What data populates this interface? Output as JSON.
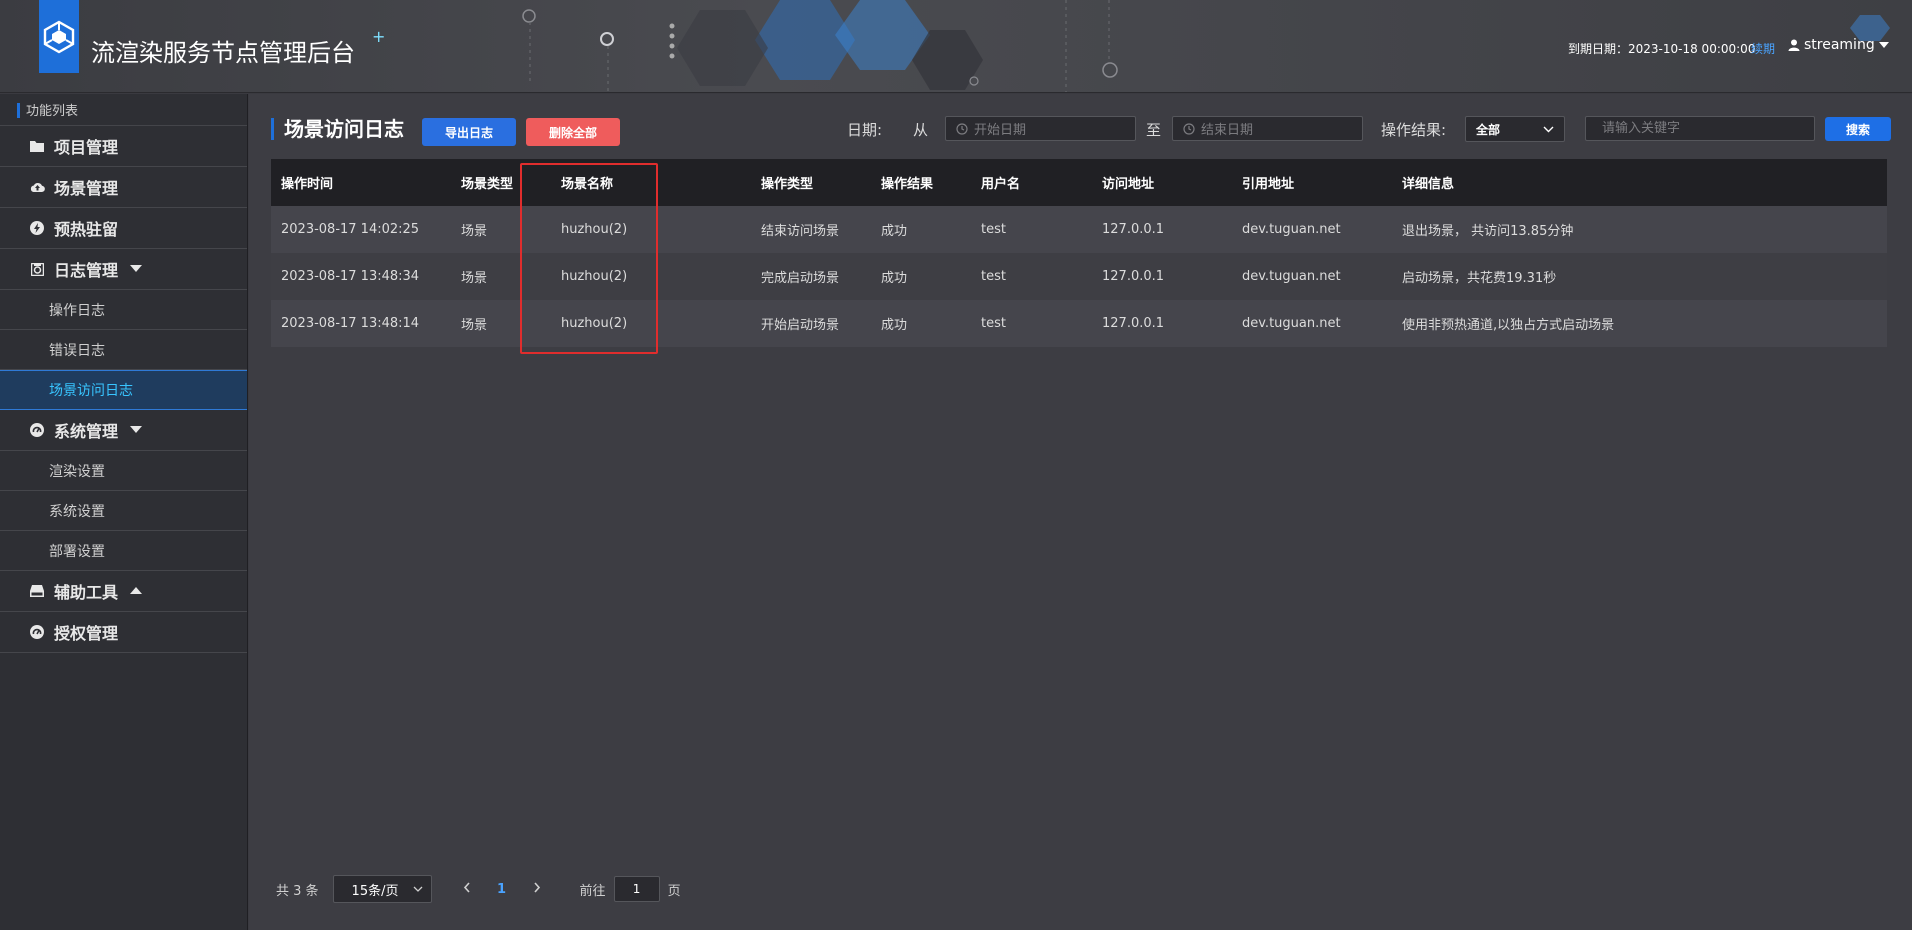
{
  "header": {
    "title": "流渲染服务节点管理后台",
    "title_suffix": "+",
    "expire_text": "到期日期：2023-10-18 00:00:00",
    "renew_label": "续期",
    "username": "streaming"
  },
  "sidebar": {
    "heading": "功能列表",
    "items": [
      {
        "label": "项目管理",
        "icon": "folder-icon"
      },
      {
        "label": "场景管理",
        "icon": "cloud-upload-icon"
      },
      {
        "label": "预热驻留",
        "icon": "bolt-icon"
      },
      {
        "label": "日志管理",
        "icon": "log-icon",
        "arrow": "down"
      },
      {
        "label": "系统管理",
        "icon": "dashboard-icon",
        "arrow": "down"
      },
      {
        "label": "辅助工具",
        "icon": "drive-icon",
        "arrow": "up"
      },
      {
        "label": "授权管理",
        "icon": "dashboard-icon"
      }
    ],
    "log_sub": [
      "操作日志",
      "错误日志",
      "场景访问日志"
    ],
    "sys_sub": [
      "渲染设置",
      "系统设置",
      "部署设置"
    ],
    "active_item": "场景访问日志"
  },
  "toolbar": {
    "page_title": "场景访问日志",
    "export_label": "导出日志",
    "delete_label": "删除全部",
    "date_label": "日期:",
    "from_label": "从",
    "to_label": "至",
    "start_placeholder": "开始日期",
    "end_placeholder": "结束日期",
    "result_label": "操作结果:",
    "result_value": "全部",
    "keyword_placeholder": "请输入关键字",
    "search_label": "搜索"
  },
  "table": {
    "headers": [
      "操作时间",
      "场景类型",
      "场景名称",
      "操作类型",
      "操作结果",
      "用户名",
      "访问地址",
      "引用地址",
      "详细信息"
    ],
    "rows": [
      [
        "2023-08-17 14:02:25",
        "场景",
        "huzhou(2)",
        "结束访问场景",
        "成功",
        "test",
        "127.0.0.1",
        "dev.tuguan.net",
        "退出场景， 共访问13.85分钟"
      ],
      [
        "2023-08-17 13:48:34",
        "场景",
        "huzhou(2)",
        "完成启动场景",
        "成功",
        "test",
        "127.0.0.1",
        "dev.tuguan.net",
        "启动场景，共花费19.31秒"
      ],
      [
        "2023-08-17 13:48:14",
        "场景",
        "huzhou(2)",
        "开始启动场景",
        "成功",
        "test",
        "127.0.0.1",
        "dev.tuguan.net",
        "使用非预热通道,以独占方式启动场景"
      ]
    ]
  },
  "pager": {
    "total_text": "共 3 条",
    "page_size": "15条/页",
    "current_page": "1",
    "goto_label": "前往",
    "goto_value": "1",
    "page_unit": "页"
  },
  "colors": {
    "accent": "#1e6fd9",
    "danger": "#ef5c5c",
    "highlight_box": "#e02d2d",
    "active_text": "#38c5ff"
  }
}
